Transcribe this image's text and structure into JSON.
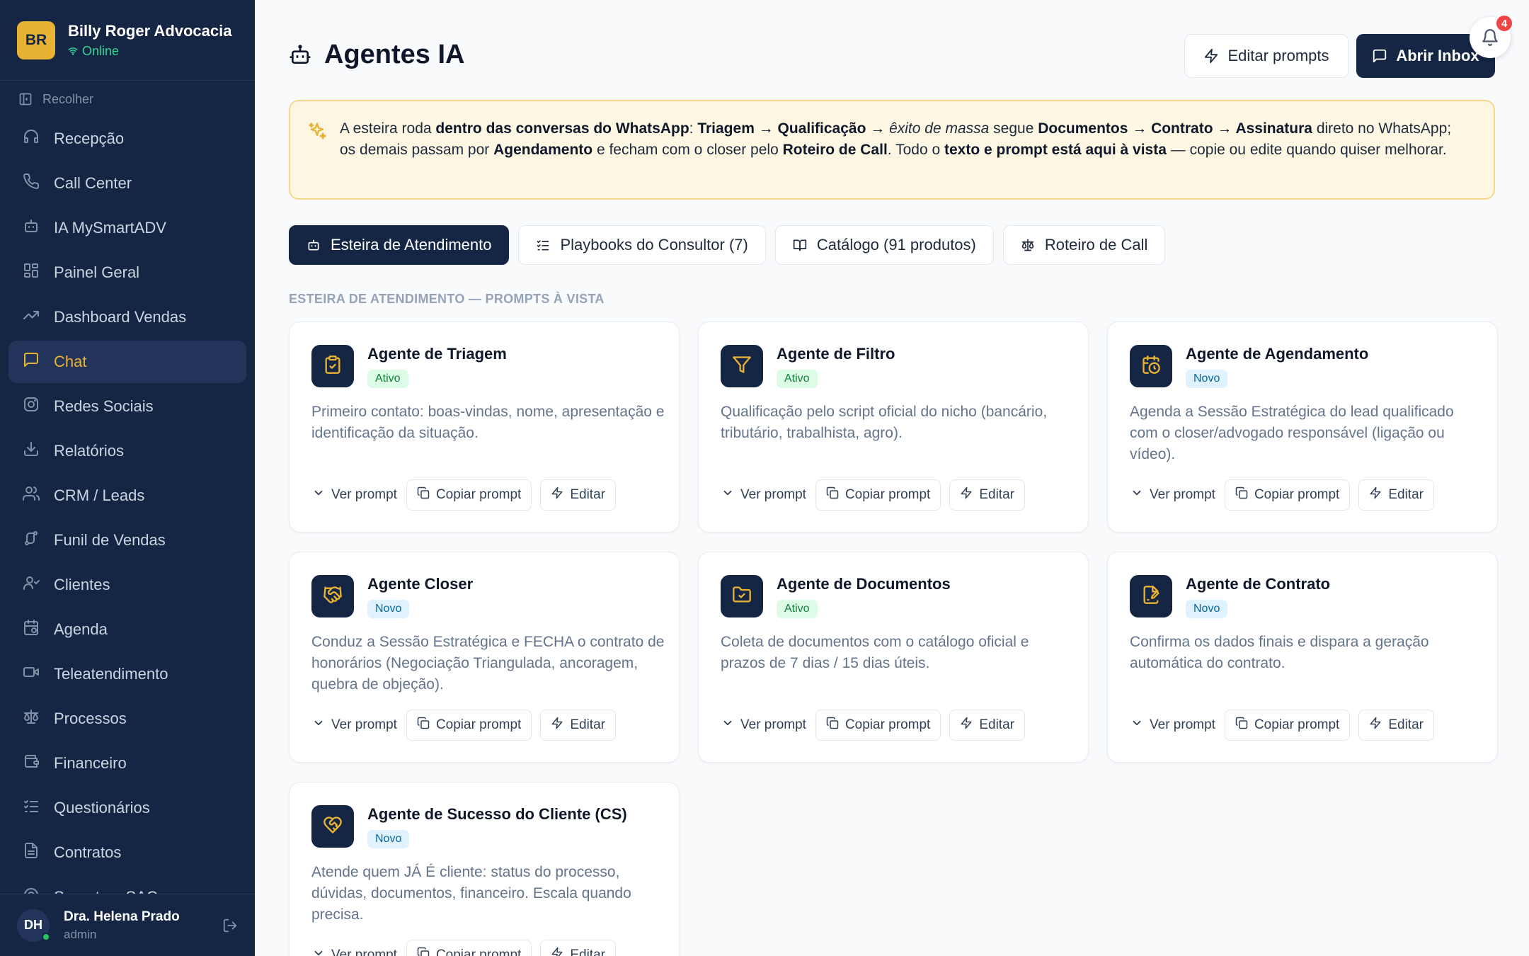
{
  "brand": {
    "initials": "BR",
    "name": "Billy Roger Advocacia",
    "status": "Online"
  },
  "sidebar": {
    "collapse_label": "Recolher",
    "items": [
      {
        "label": "Recepção",
        "icon": "headset-icon"
      },
      {
        "label": "Call Center",
        "icon": "phone-icon"
      },
      {
        "label": "IA MySmartADV",
        "icon": "bot-icon"
      },
      {
        "label": "Painel Geral",
        "icon": "dashboard-icon"
      },
      {
        "label": "Dashboard Vendas",
        "icon": "trending-up-icon"
      },
      {
        "label": "Chat",
        "icon": "chat-icon"
      },
      {
        "label": "Redes Sociais",
        "icon": "instagram-icon"
      },
      {
        "label": "Relatórios",
        "icon": "download-icon"
      },
      {
        "label": "CRM / Leads",
        "icon": "users-icon"
      },
      {
        "label": "Funil de Vendas",
        "icon": "funnel-icon"
      },
      {
        "label": "Clientes",
        "icon": "user-icon"
      },
      {
        "label": "Agenda",
        "icon": "calendar-icon"
      },
      {
        "label": "Teleatendimento",
        "icon": "video-icon"
      },
      {
        "label": "Processos",
        "icon": "scale-icon"
      },
      {
        "label": "Financeiro",
        "icon": "wallet-icon"
      },
      {
        "label": "Questionários",
        "icon": "list-check-icon"
      },
      {
        "label": "Contratos",
        "icon": "file-icon"
      },
      {
        "label": "Suporte e SAC",
        "icon": "support-icon"
      }
    ],
    "active": "Chat"
  },
  "user": {
    "initials": "DH",
    "name": "Dra. Helena Prado",
    "role": "admin"
  },
  "header": {
    "title": "Agentes IA",
    "edit_prompts": "Editar prompts",
    "open_inbox": "Abrir Inbox",
    "notifications": "4"
  },
  "banner": {
    "t1": "A esteira roda ",
    "b1": "dentro das conversas do WhatsApp",
    "t2": ": ",
    "b2": "Triagem → Qualificação →",
    "i1": " êxito de massa",
    "t3": " segue ",
    "b3": "Documentos → Contrato → Assinatura",
    "t4": " direto no WhatsApp; os demais passam por ",
    "b4": "Agendamento",
    "t5": " e fecham com o closer pelo ",
    "b5": "Roteiro de Call",
    "t6": ". Todo o ",
    "b6": "texto e prompt está aqui à vista",
    "t7": " — copie ou edite quando quiser melhorar."
  },
  "tabs": [
    {
      "label": "Esteira de Atendimento"
    },
    {
      "label": "Playbooks do Consultor (7)"
    },
    {
      "label": "Catálogo (91 produtos)"
    },
    {
      "label": "Roteiro de Call"
    }
  ],
  "section_label": "ESTEIRA DE ATENDIMENTO — PROMPTS À VISTA",
  "actions": {
    "view": "Ver prompt",
    "copy": "Copiar prompt",
    "edit": "Editar"
  },
  "agents": [
    {
      "title": "Agente de Triagem",
      "status": "Ativo",
      "icon": "clipboard-check-icon",
      "desc": "Primeiro contato: boas-vindas, nome, apresentação e identificação da situação."
    },
    {
      "title": "Agente de Filtro",
      "status": "Ativo",
      "icon": "filter-icon",
      "desc": "Qualificação pelo script oficial do nicho (bancário, tributário, trabalhista, agro)."
    },
    {
      "title": "Agente de Agendamento",
      "status": "Novo",
      "icon": "calendar-clock-icon",
      "desc": "Agenda a Sessão Estratégica do lead qualificado com o closer/advogado responsável (ligação ou vídeo)."
    },
    {
      "title": "Agente Closer",
      "status": "Novo",
      "icon": "handshake-icon",
      "desc": "Conduz a Sessão Estratégica e FECHA o contrato de honorários (Negociação Triangulada, ancoragem, quebra de objeção)."
    },
    {
      "title": "Agente de Documentos",
      "status": "Ativo",
      "icon": "folder-check-icon",
      "desc": "Coleta de documentos com o catálogo oficial e prazos de 7 dias / 15 dias úteis."
    },
    {
      "title": "Agente de Contrato",
      "status": "Novo",
      "icon": "file-signature-icon",
      "desc": "Confirma os dados finais e dispara a geração automática do contrato."
    },
    {
      "title": "Agente de Sucesso do Cliente (CS)",
      "status": "Novo",
      "icon": "heart-handshake-icon",
      "desc": "Atende quem JÁ É cliente: status do processo, dúvidas, documentos, financeiro. Escala quando precisa."
    }
  ]
}
